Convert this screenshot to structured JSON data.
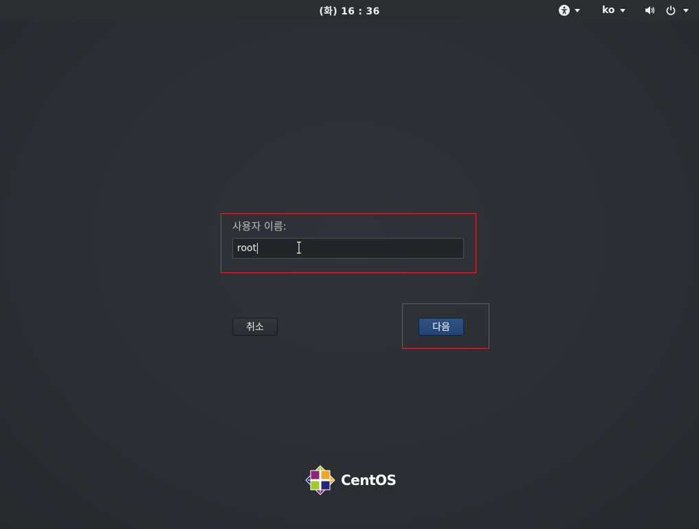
{
  "topbar": {
    "clock": "(화) 16 : 36",
    "language": "ko",
    "icons": [
      "accessibility-icon",
      "volume-icon",
      "power-icon"
    ]
  },
  "login": {
    "username_label": "사용자 이름:",
    "username_value": "root",
    "cancel_label": "취소",
    "next_label": "다음"
  },
  "logo": {
    "text": "CentOS"
  },
  "colors": {
    "background": "#2b2e31",
    "highlight_box": "#e02c2c",
    "next_button": "#234575"
  }
}
